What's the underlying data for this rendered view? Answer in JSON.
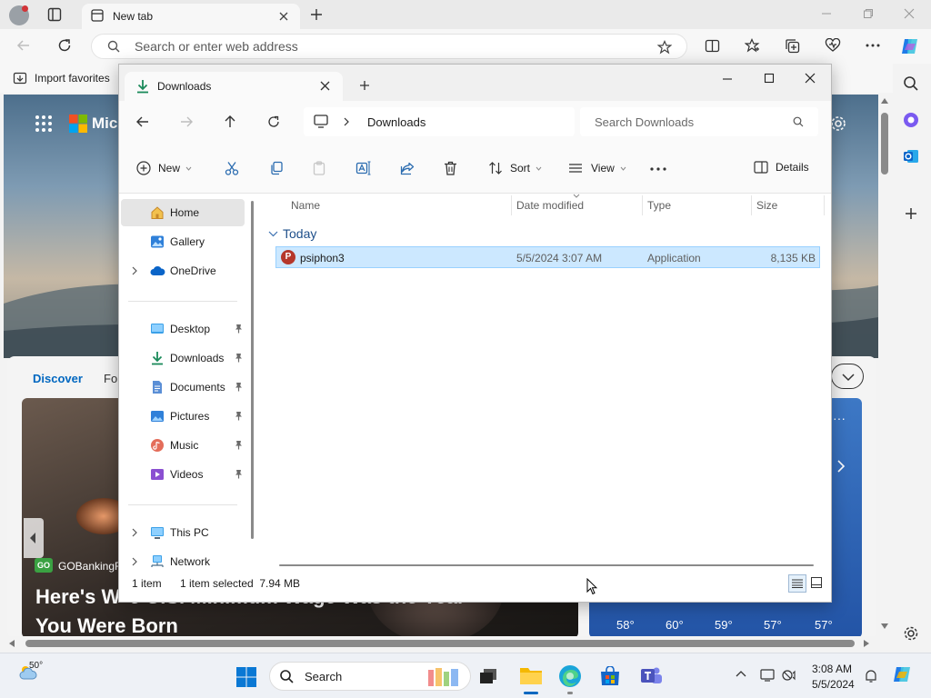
{
  "browser": {
    "tab_title": "New tab",
    "address_placeholder": "Search or enter web address",
    "favorites_import": "Import favorites"
  },
  "ntp": {
    "logo_text": "Micr",
    "feed_tabs": [
      "Discover",
      "Fo"
    ],
    "news_source": "GOBankingR",
    "news_headline_line1": "Here's W",
    "news_headline_line1_tail": "e U.S. Minimum Wage Was the Year",
    "news_headline_line2": "You Were Born",
    "weather_temps": [
      "58°",
      "60°",
      "59°",
      "57°",
      "57°"
    ]
  },
  "explorer": {
    "tab_title": "Downloads",
    "breadcrumb": "Downloads",
    "search_placeholder": "Search Downloads",
    "commands": {
      "new": "New",
      "sort": "Sort",
      "view": "View",
      "details": "Details"
    },
    "nav": {
      "home": "Home",
      "gallery": "Gallery",
      "onedrive": "OneDrive",
      "desktop": "Desktop",
      "downloads": "Downloads",
      "documents": "Documents",
      "pictures": "Pictures",
      "music": "Music",
      "videos": "Videos",
      "thispc": "This PC",
      "network": "Network"
    },
    "columns": {
      "name": "Name",
      "date": "Date modified",
      "type": "Type",
      "size": "Size"
    },
    "group": "Today",
    "files": [
      {
        "name": "psiphon3",
        "date": "5/5/2024 3:07 AM",
        "type": "Application",
        "size": "8,135 KB"
      }
    ],
    "status": {
      "count": "1 item",
      "selected": "1 item selected  7.94 MB"
    }
  },
  "taskbar": {
    "weather_temp": "50°",
    "search_label": "Search",
    "time": "3:08 AM",
    "date": "5/5/2024"
  },
  "colors": {
    "accent": "#0067c0",
    "selection": "#cce8ff",
    "psiphon": "#b5372b"
  }
}
